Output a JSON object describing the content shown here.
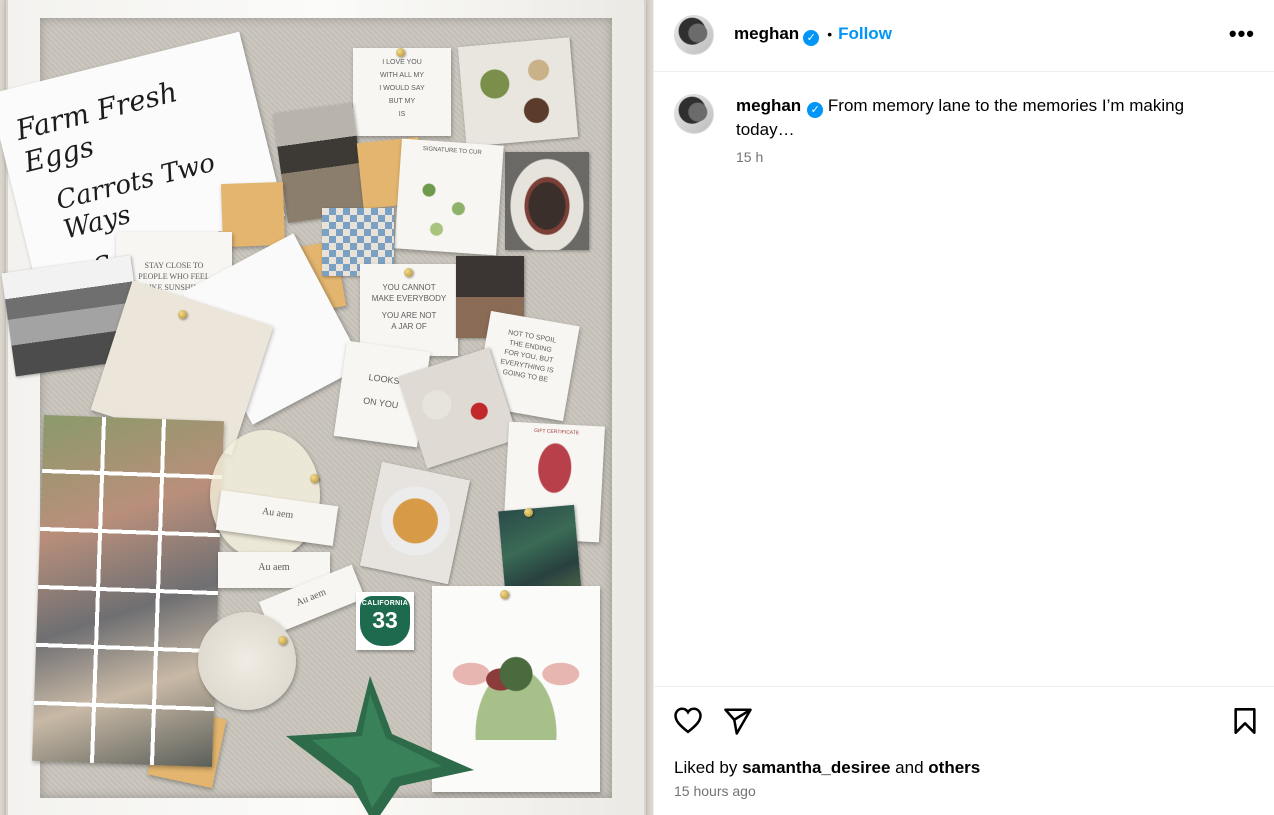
{
  "post": {
    "author": "meghan",
    "verified_mark": "✓",
    "separator": "•",
    "follow_label": "Follow",
    "more_label": "•••",
    "caption_author": "meghan",
    "caption_text": "From memory lane to the memories I’m making today…",
    "caption_time": "15 h",
    "liked_prefix": "Liked by",
    "liked_user": "samantha_desiree",
    "liked_and": "and",
    "liked_others": "others",
    "posted_ago": "15 hours ago"
  },
  "icons": {
    "like": "heart-icon",
    "share": "paper-plane-icon",
    "save": "bookmark-icon",
    "more": "more-options-icon",
    "verified": "verified-badge-icon"
  },
  "colors": {
    "accent": "#0095f6",
    "muted": "#737373",
    "divider": "#efefef"
  },
  "board": {
    "card_calligraphy": [
      "Farm Fresh Eggs",
      "Carrots Two Ways",
      "Sweet Treats"
    ],
    "card_love": [
      "I LOVE YOU",
      "WITH ALL MY",
      "I WOULD SAY",
      "BUT MY",
      "IS"
    ],
    "card_sunshine": [
      "STAY CLOSE TO",
      "PEOPLE WHO FEEL",
      "LIKE SUNSHINE"
    ],
    "card_nutella": [
      "YOU CANNOT",
      "MAKE EVERYBODY",
      "YOU ARE NOT",
      "A JAR OF"
    ],
    "card_spoil": [
      "NOT TO SPOIL",
      "THE ENDING",
      "FOR YOU, BUT",
      "EVERYTHING IS",
      "GOING TO BE"
    ],
    "card_gorgeous": [
      "LOOKS",
      "ON YOU"
    ],
    "card_signature": "SIGNATURE TO CUR",
    "card_gift": "GIFT CERTIFICATE",
    "ribbon_brand": "Au aem",
    "sign_state": "CALIFORNIA",
    "sign_number": "33"
  }
}
